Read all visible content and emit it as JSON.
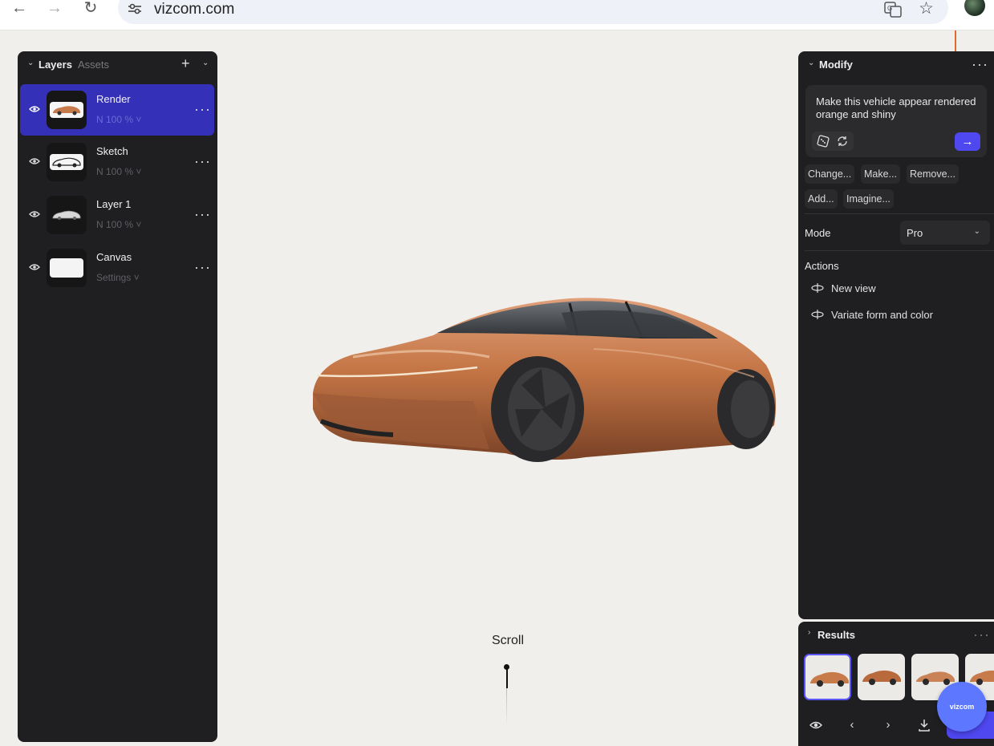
{
  "browser": {
    "url": "vizcom.com"
  },
  "layers_panel": {
    "tab_layers": "Layers",
    "tab_assets": "Assets",
    "add": "+",
    "layers": [
      {
        "name": "Render",
        "meta": "N  100 %  ˅",
        "selected": true
      },
      {
        "name": "Sketch",
        "meta": "N  100 %  ˅",
        "selected": false
      },
      {
        "name": "Layer 1",
        "meta": "N  100 %  ˅",
        "selected": false
      },
      {
        "name": "Canvas",
        "meta": "Settings  ˅",
        "selected": false
      }
    ]
  },
  "canvas": {
    "scroll_label": "Scroll"
  },
  "modify_panel": {
    "title": "Modify",
    "prompt_text": "Make this vehicle appear rendered orange and shiny",
    "send_label": "→",
    "chips": [
      "Change...",
      "Make...",
      "Remove...",
      "Add...",
      "Imagine..."
    ],
    "mode_label": "Mode",
    "mode_value": "Pro",
    "actions_label": "Actions",
    "actions": [
      "New view",
      "Variate form and color"
    ]
  },
  "results_panel": {
    "title": "Results",
    "badge": "vizcom"
  },
  "colors": {
    "panel_bg": "#1f1f21",
    "selection": "#3530b8",
    "accent": "#4f47f0",
    "canvas_bg": "#f1efeb",
    "car_body": "#c77a4a"
  }
}
